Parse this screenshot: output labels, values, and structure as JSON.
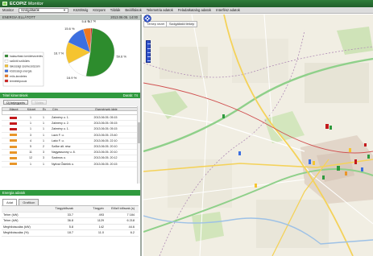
{
  "app": {
    "name_bold": "ECOPIZ",
    "name_thin": "Monitor"
  },
  "menu": {
    "items": [
      "Monitor",
      "Közöltség",
      "Központ",
      "Táblák",
      "Beállítások",
      "Telemetria adatok",
      "Feladatkatalog adatok",
      "Interfész adatok"
    ],
    "dropdown_value": "Szolgáltatók"
  },
  "chart_panel": {
    "title": "ENERGIA ELLÁTOTT",
    "timestamp": "2013.06.05. 14:00"
  },
  "chart_data": {
    "type": "pie",
    "values": [
      59.6,
      16.9,
      16.7,
      15.6,
      5.8,
      1.1
    ],
    "labels": [
      "59.6 %",
      "16.9 %",
      "16.7 %",
      "15.6 %",
      "5.8 %",
      "1.1 %"
    ],
    "colors": [
      "#2d8c2d",
      "#ffffff",
      "#f5c430",
      "#3c6fe0",
      "#f07820",
      "#d71d1d"
    ],
    "legend": [
      {
        "label": "halasztható kerületvezérlés",
        "color": "#2d8c2d"
      },
      {
        "label": "szűkítő szűkülés",
        "color": "#ffffff"
      },
      {
        "label": "lakossági szerkezetszám",
        "color": "#f5c430"
      },
      {
        "label": "közösségi energia",
        "color": "#3c6fe0"
      },
      {
        "label": "erős-kezdetes",
        "color": "#f07820"
      },
      {
        "label": "terméktípusok",
        "color": "#d71d1d"
      }
    ]
  },
  "table_panel": {
    "title": "Tétel kimentések",
    "count": "Darab: 74",
    "buttons": [
      "Új bejegyzés",
      "Törlés"
    ],
    "columns": [
      "Állapot",
      "Körzet",
      "Év",
      "Cím",
      "Események ideje"
    ],
    "rows": [
      {
        "status_color": "#c3191c",
        "zone": "1",
        "year": "1",
        "name": "Zalmény u. 1.",
        "time": "2013.06.05. 05:15"
      },
      {
        "status_color": "#c3191c",
        "zone": "1",
        "year": "1",
        "name": "Zalmény u. 2.",
        "time": "2013.06.05. 05:15"
      },
      {
        "status_color": "#c3191c",
        "zone": "1",
        "year": "1",
        "name": "Zalmény u. 1.",
        "time": "2013.06.05. 05:15"
      },
      {
        "status_color": "#e8962a",
        "zone": "3",
        "year": "1",
        "name": "Lazó F. u.",
        "time": "2013.06.05. 23:40"
      },
      {
        "status_color": "#e8962a",
        "zone": "4",
        "year": "1",
        "name": "Lakó F. u.",
        "time": "2013.06.05. 22:10"
      },
      {
        "status_color": "#e8962a",
        "zone": "5",
        "year": "2",
        "name": "Szőke ált. rész",
        "time": "2013.06.05. 20:10"
      },
      {
        "status_color": "#e8962a",
        "zone": "11",
        "year": "3",
        "name": "Nagyasszony u. 8.",
        "time": "2013.06.05. 20:10"
      },
      {
        "status_color": "#e8962a",
        "zone": "12",
        "year": "3",
        "name": "Szalmos u.",
        "time": "2013.06.05. 20:12"
      },
      {
        "status_color": "#e8962a",
        "zone": "1",
        "year": "1",
        "name": "Nyilvai Őstelek u.",
        "time": "2013.06.05. 20:15"
      }
    ]
  },
  "stats_panel": {
    "title": "Energia adatok",
    "tabs": [
      "Adat",
      "Grafikon"
    ],
    "columns": [
      "Tárgyidőszak",
      "Tárgyév",
      "Előző időszak (s)"
    ],
    "rows": [
      {
        "label": "Teher (kW)",
        "a": "33.7",
        "b": "493",
        "c": "7 184"
      },
      {
        "label": "Teher (kW)",
        "a": "36.8",
        "b": "1129",
        "c": "6 218"
      },
      {
        "label": "Meghibásodás (kW)",
        "a": "5.8",
        "b": "142",
        "c": "44.6"
      },
      {
        "label": "Meghibásodás (%)",
        "a": "18.7",
        "b": "11.0",
        "c": "6.2"
      }
    ]
  },
  "map": {
    "tabs": [
      "Térkép nézet",
      "Szolgáltatói térkép"
    ]
  }
}
